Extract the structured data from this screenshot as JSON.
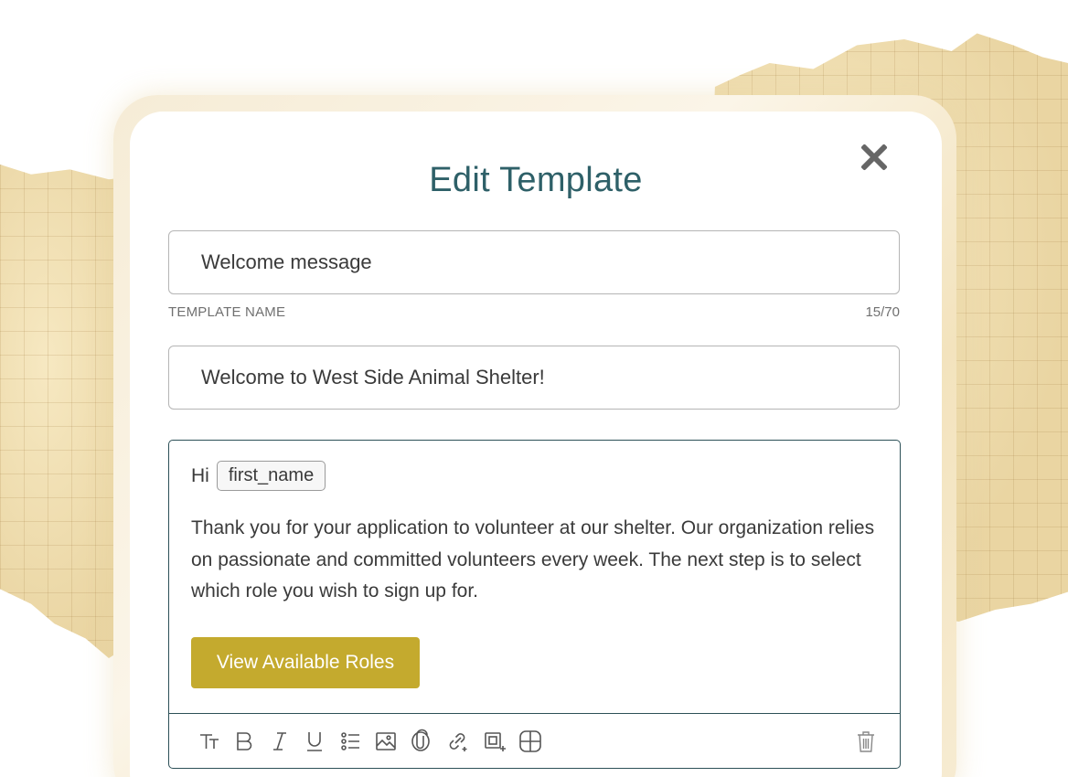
{
  "modal": {
    "title": "Edit Template",
    "close_icon": "close-icon"
  },
  "template_name": {
    "value": "Welcome message",
    "label": "TEMPLATE NAME",
    "counter": "15/70"
  },
  "subject": {
    "value": "Welcome to West Side Animal Shelter!"
  },
  "editor": {
    "greeting": "Hi",
    "variable_chip": "first_name",
    "body": "Thank you for your application to volunteer at our shelter. Our organization relies on passionate and committed volunteers every week. The next step is to select which role you wish to sign up for.",
    "button_label": "View Available Roles"
  },
  "toolbar": {
    "icons": [
      "text-style-icon",
      "bold-icon",
      "italic-icon",
      "underline-icon",
      "list-icon",
      "image-icon",
      "attachment-icon",
      "link-icon",
      "button-insert-icon",
      "table-icon"
    ],
    "delete_icon": "trash-icon"
  },
  "colors": {
    "title": "#2e6068",
    "accent_button": "#c4aa2e",
    "editor_border": "#2c5057"
  }
}
